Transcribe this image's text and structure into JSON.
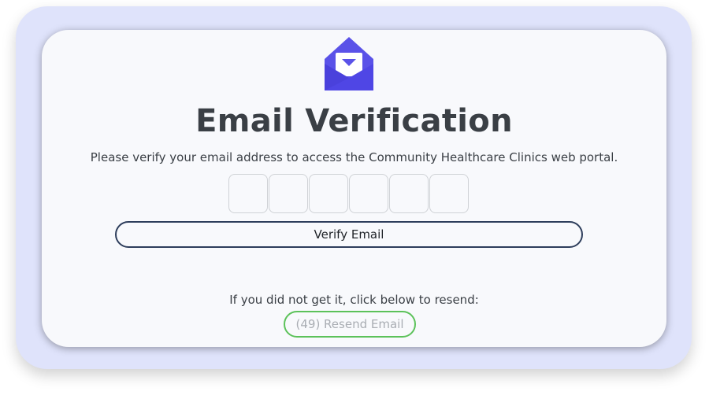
{
  "card": {
    "logo_icon": "envelope-open-icon",
    "title": "Email Verification",
    "subtitle": "Please verify your email address to access the Community Healthcare Clinics web portal.",
    "code_digits": [
      "",
      "",
      "",
      "",
      "",
      ""
    ],
    "verify_label": "Verify Email",
    "resend_prompt": "If you did not get it, click below to resend:",
    "resend_label": "(49) Resend Email"
  },
  "colors": {
    "frame_bg": "#dfe3fb",
    "card_bg": "#f8f9fc",
    "logo_primary": "#4f46e5",
    "verify_border": "#2e3e5c",
    "resend_border": "#5cc25a",
    "resend_text_disabled": "#a9adb3"
  }
}
